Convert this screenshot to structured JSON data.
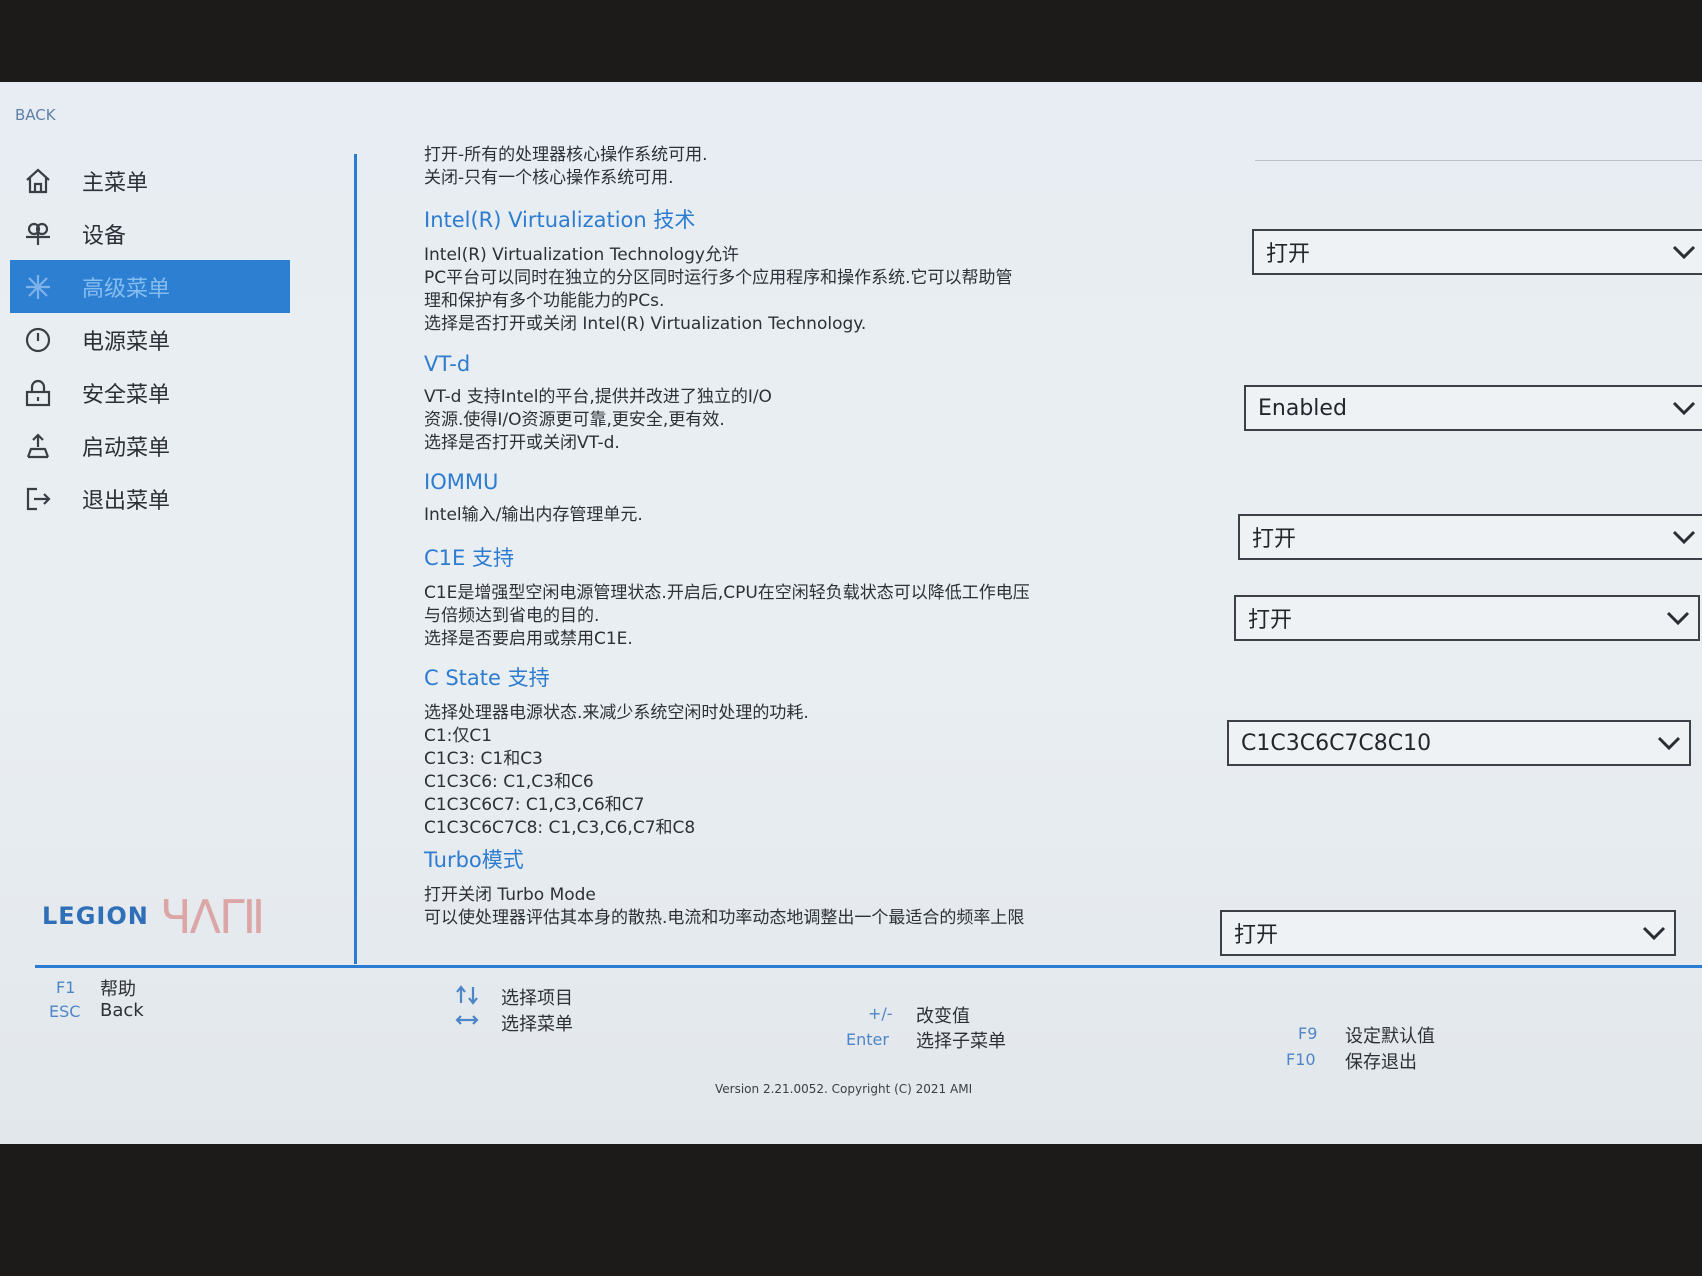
{
  "header": {
    "back_label": "BACK"
  },
  "sidebar": {
    "items": [
      {
        "label": "主菜单",
        "icon": "home-icon"
      },
      {
        "label": "设备",
        "icon": "device-icon"
      },
      {
        "label": "高级菜单",
        "icon": "advanced-icon",
        "active": true
      },
      {
        "label": "电源菜单",
        "icon": "power-icon"
      },
      {
        "label": "安全菜单",
        "icon": "lock-icon"
      },
      {
        "label": "启动菜单",
        "icon": "boot-icon"
      },
      {
        "label": "退出菜单",
        "icon": "exit-icon"
      }
    ]
  },
  "brand": {
    "logo": "LEGION"
  },
  "main": {
    "intro": [
      "打开-所有的处理器核心操作系统可用.",
      "关闭-只有一个核心操作系统可用."
    ],
    "settings": [
      {
        "title": "Intel(R) Virtualization 技术",
        "desc": [
          "Intel(R) Virtualization Technology允许",
          "PC平台可以同时在独立的分区同时运行多个应用程序和操作系统.它可以帮助管",
          "理和保护有多个功能能力的PCs.",
          "选择是否打开或关闭 Intel(R) Virtualization Technology."
        ],
        "value": "打开"
      },
      {
        "title": "VT-d",
        "desc": [
          "VT-d 支持Intel的平台,提供并改进了独立的I/O",
          "资源.使得I/O资源更可靠,更安全,更有效.",
          "选择是否打开或关闭VT-d."
        ],
        "value": "Enabled"
      },
      {
        "title": "IOMMU",
        "desc": [
          "Intel输入/输出内存管理单元."
        ],
        "value": "打开"
      },
      {
        "title": "C1E 支持",
        "desc": [
          "C1E是增强型空闲电源管理状态.开启后,CPU在空闲轻负载状态可以降低工作电压",
          "与倍频达到省电的目的.",
          "选择是否要启用或禁用C1E."
        ],
        "value": "打开"
      },
      {
        "title": "C State 支持",
        "desc": [
          "选择处理器电源状态.来减少系统空闲时处理的功耗.",
          "C1:仅C1",
          "C1C3: C1和C3",
          "C1C3C6: C1,C3和C6",
          "C1C3C6C7: C1,C3,C6和C7",
          "C1C3C6C7C8: C1,C3,C6,C7和C8"
        ],
        "value": "C1C3C6C7C8C10"
      },
      {
        "title": "Turbo模式",
        "desc": [
          "打开关闭 Turbo Mode",
          "可以使处理器评估其本身的散热.电流和功率动态地调整出一个最适合的频率上限"
        ],
        "value": "打开"
      }
    ]
  },
  "footer": {
    "f1_key": "F1",
    "f1_label": "帮助",
    "esc_key": "ESC",
    "esc_label": "Back",
    "updown_label": "选择项目",
    "leftright_label": "选择菜单",
    "plusminus_key": "+/-",
    "plusminus_label": "改变值",
    "enter_key": "Enter",
    "enter_label": "选择子菜单",
    "f9_key": "F9",
    "f9_label": "设定默认值",
    "f10_key": "F10",
    "f10_label": "保存退出",
    "version": "Version 2.21.0052. Copyright (C) 2021 AMI"
  }
}
